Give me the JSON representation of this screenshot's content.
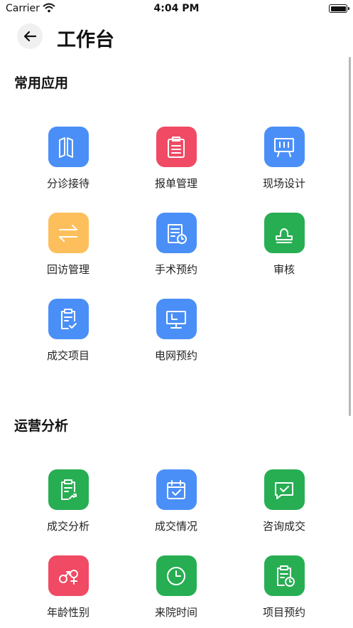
{
  "status_bar": {
    "carrier": "Carrier",
    "time": "4:04 PM"
  },
  "nav": {
    "title": "工作台"
  },
  "sections": [
    {
      "title": "常用应用",
      "items": [
        {
          "label": "分诊接待",
          "icon": "map-icon",
          "color": "#4A8FF7"
        },
        {
          "label": "报单管理",
          "icon": "clipboard-icon",
          "color": "#F04A64"
        },
        {
          "label": "现场设计",
          "icon": "easel-icon",
          "color": "#4A8FF7"
        },
        {
          "label": "回访管理",
          "icon": "swap-arrows-icon",
          "color": "#FDBF5C"
        },
        {
          "label": "手术预约",
          "icon": "document-clock-icon",
          "color": "#4A8FF7"
        },
        {
          "label": "审核",
          "icon": "stamp-icon",
          "color": "#27AE52"
        },
        {
          "label": "成交项目",
          "icon": "clipboard-check-icon",
          "color": "#4A8FF7"
        },
        {
          "label": "电网预约",
          "icon": "monitor-icon",
          "color": "#4A8FF7"
        }
      ]
    },
    {
      "title": "运营分析",
      "items": [
        {
          "label": "成交分析",
          "icon": "clipboard-chart-icon",
          "color": "#27AE52"
        },
        {
          "label": "成交情况",
          "icon": "calendar-check-icon",
          "color": "#4A8FF7"
        },
        {
          "label": "咨询成交",
          "icon": "chat-check-icon",
          "color": "#27AE52"
        },
        {
          "label": "年龄性别",
          "icon": "gender-icon",
          "color": "#F04A64"
        },
        {
          "label": "来院时间",
          "icon": "clock-icon",
          "color": "#27AE52"
        },
        {
          "label": "项目预约",
          "icon": "clipboard-clock-icon",
          "color": "#27AE52"
        }
      ]
    }
  ]
}
